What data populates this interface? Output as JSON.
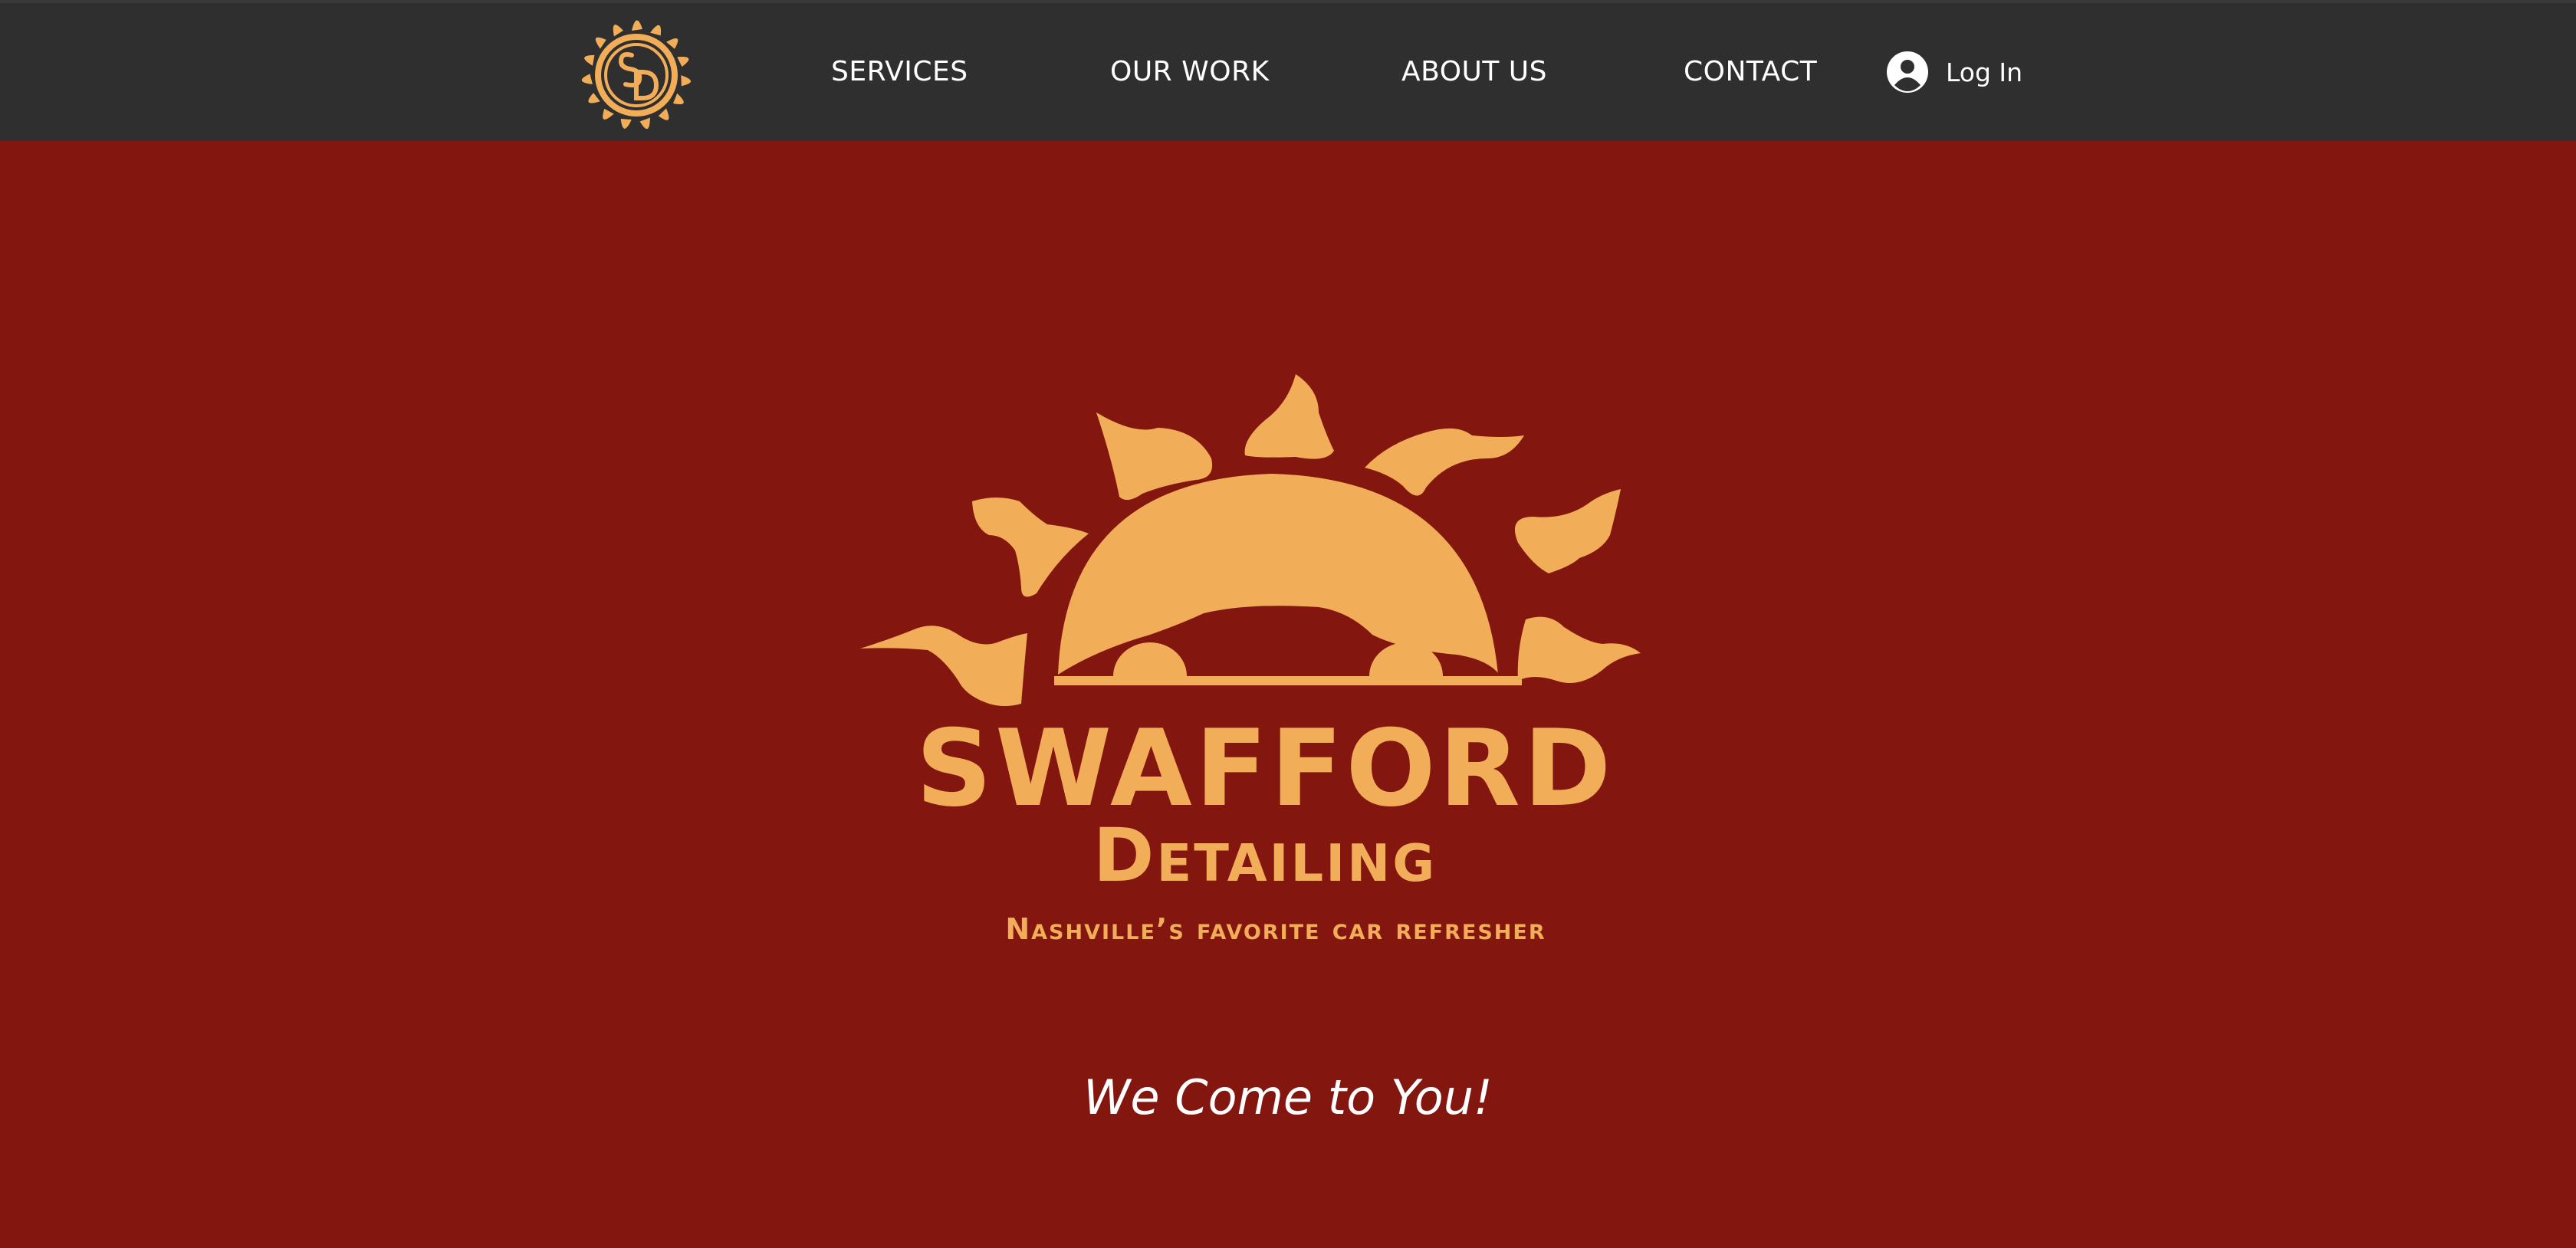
{
  "header": {
    "logo_icon": "swafford-detailing-sun-monogram",
    "nav": [
      {
        "label": "SERVICES"
      },
      {
        "label": "OUR WORK"
      },
      {
        "label": "ABOUT US"
      },
      {
        "label": "CONTACT"
      }
    ],
    "login": {
      "icon": "user-avatar-icon",
      "label": "Log In"
    }
  },
  "hero": {
    "logo": {
      "icon": "sun-and-car-logo",
      "brand_line1": "SWAFFORD",
      "brand_line2": "Detailing",
      "subtitle": "Nashville’s favorite car refresher"
    },
    "tagline": "We Come to You!"
  },
  "colors": {
    "header_bg": "#2f2f2f",
    "hero_bg": "#831710",
    "logo_gold": "#f1ad58",
    "nav_text": "#ffffff"
  }
}
